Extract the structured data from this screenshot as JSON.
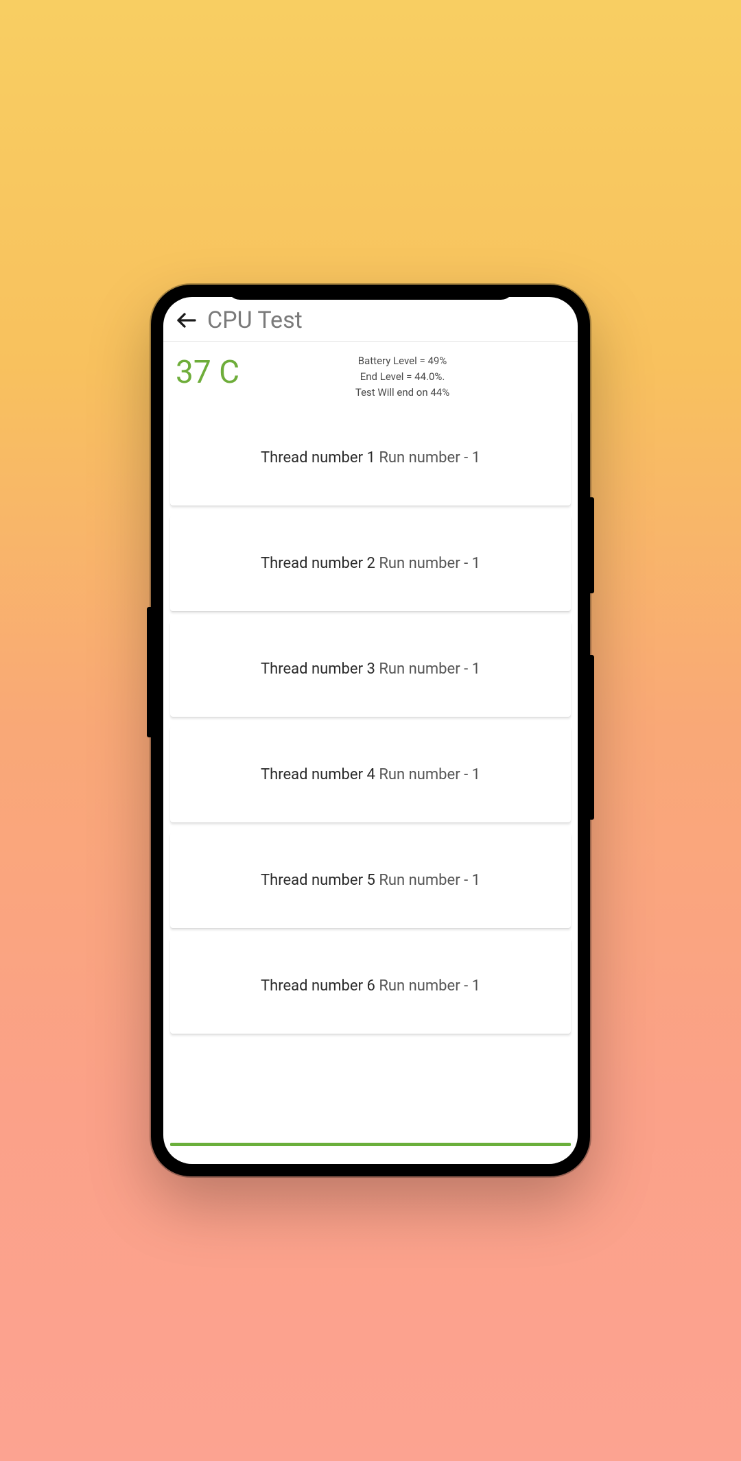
{
  "header": {
    "title": "CPU Test"
  },
  "status": {
    "temperature": "37 C",
    "battery_level": "Battery Level = 49%",
    "end_level": "End Level = 44.0%.",
    "test_end": "Test Will end on 44%"
  },
  "threads": [
    {
      "thread_label": "Thread number 1 ",
      "run_label": "Run number - 1"
    },
    {
      "thread_label": "Thread number 2 ",
      "run_label": "Run number - 1"
    },
    {
      "thread_label": "Thread number 3 ",
      "run_label": "Run number - 1"
    },
    {
      "thread_label": "Thread number 4 ",
      "run_label": "Run number - 1"
    },
    {
      "thread_label": "Thread number 5 ",
      "run_label": "Run number - 1"
    },
    {
      "thread_label": "Thread number 6 ",
      "run_label": "Run number - 1"
    }
  ]
}
